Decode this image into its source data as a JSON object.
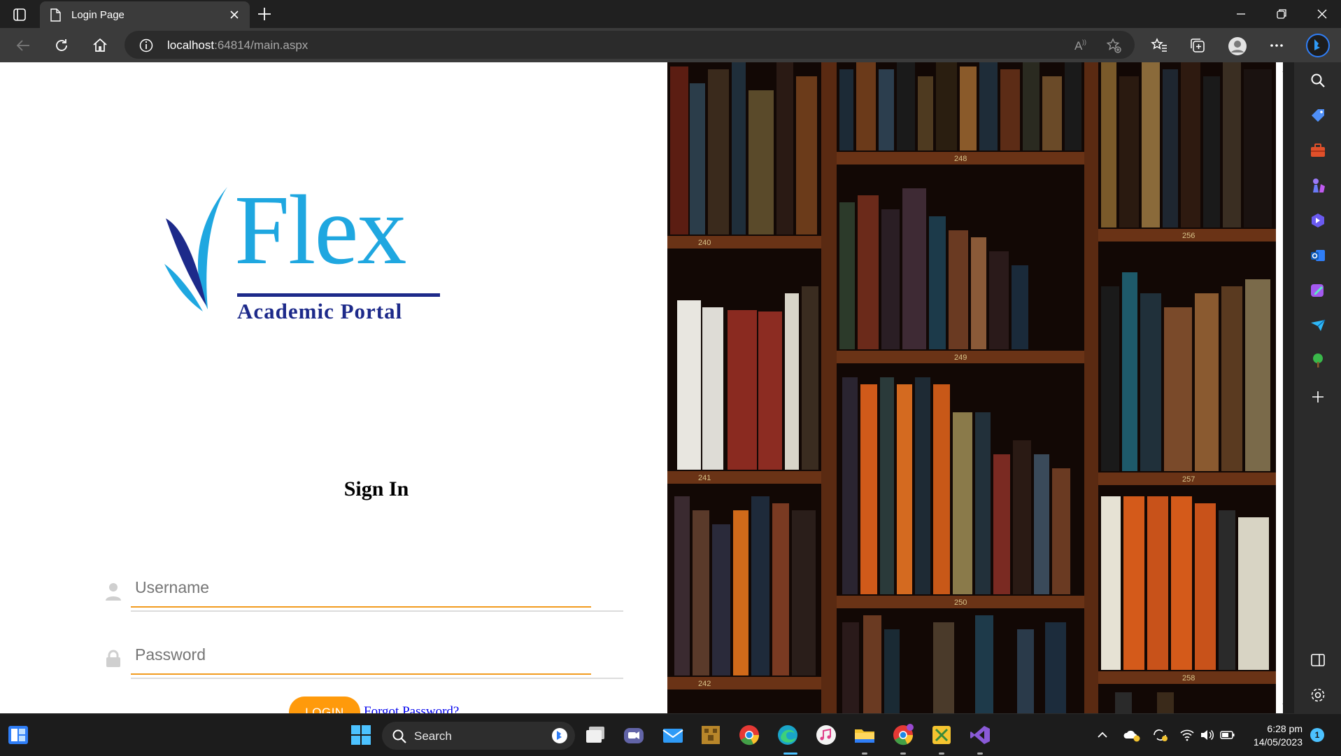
{
  "browser": {
    "tab_title": "Login Page",
    "address_host": "localhost",
    "address_rest": ":64814/main.aspx"
  },
  "page": {
    "logo_word": "Flex",
    "logo_subtitle": "Academic Portal",
    "signin_title": "Sign In",
    "username_placeholder": "Username",
    "password_placeholder": "Password",
    "login_label": "LOGIN",
    "forgot_label": "Forgot Password?",
    "accent_color": "#ff9a0b"
  },
  "bookshelf": {
    "shelf_labels": [
      "240",
      "248",
      "256",
      "249",
      "241",
      "257",
      "250",
      "242",
      "258"
    ]
  },
  "taskbar": {
    "search_label": "Search",
    "time": "6:28 pm",
    "date": "14/05/2023",
    "notification_count": "1"
  },
  "icons": {
    "sidebar": [
      "search-icon",
      "tag-icon",
      "briefcase-icon",
      "chess-icon",
      "copilot-icon",
      "outlook-icon",
      "designer-icon",
      "send-icon",
      "tree-icon",
      "add-icon",
      "split-screen-icon",
      "settings-icon"
    ],
    "taskbar": [
      "widgets-icon",
      "start-icon",
      "bing-icon",
      "task-view-icon",
      "teams-icon",
      "mail-icon",
      "minecraft-icon",
      "chrome-icon",
      "edge-icon",
      "itunes-icon",
      "file-explorer-icon",
      "chrome-profile-icon",
      "snipping-icon",
      "visual-studio-icon"
    ]
  }
}
